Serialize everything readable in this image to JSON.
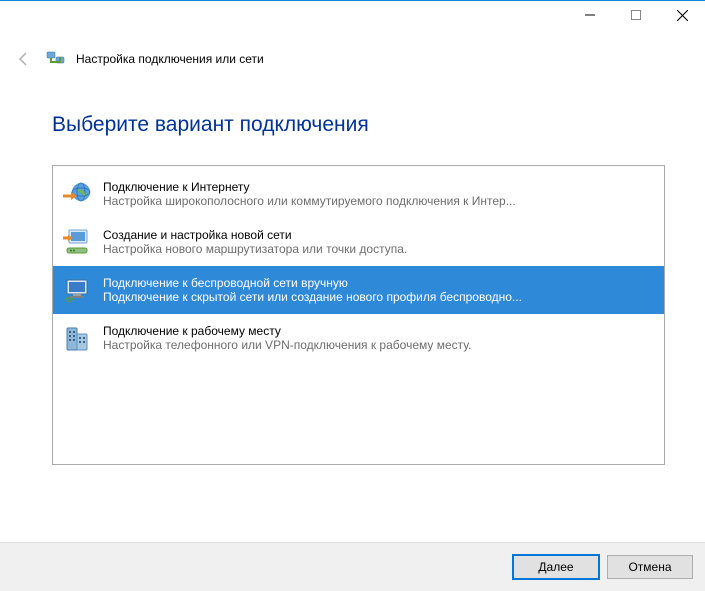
{
  "window": {
    "title": "Настройка подключения или сети",
    "heading": "Выберите вариант подключения"
  },
  "options": [
    {
      "icon": "internet-globe-icon",
      "title": "Подключение к Интернету",
      "desc": "Настройка широкополосного или коммутируемого подключения к Интер...",
      "selected": false
    },
    {
      "icon": "router-icon",
      "title": "Создание и настройка новой сети",
      "desc": "Настройка нового маршрутизатора или точки доступа.",
      "selected": false
    },
    {
      "icon": "wireless-manual-icon",
      "title": "Подключение к беспроводной сети вручную",
      "desc": "Подключение к скрытой сети или создание нового профиля беспроводно...",
      "selected": true
    },
    {
      "icon": "workplace-icon",
      "title": "Подключение к рабочему месту",
      "desc": "Настройка телефонного или VPN-подключения к рабочему месту.",
      "selected": false
    }
  ],
  "buttons": {
    "next": "Далее",
    "cancel": "Отмена"
  }
}
